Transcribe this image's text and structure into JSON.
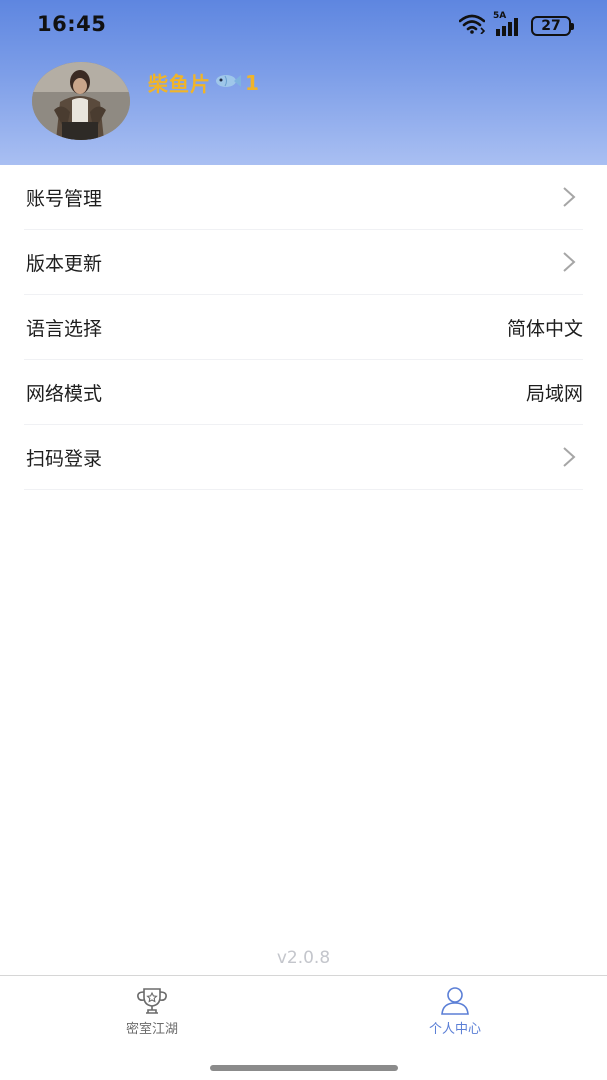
{
  "status_bar": {
    "time": "16:45",
    "network": "5A",
    "battery": "27"
  },
  "profile": {
    "username": "柴鱼片",
    "username_emoji": "🐟",
    "username_suffix": "1"
  },
  "menu": [
    {
      "label": "账号管理",
      "value": "",
      "chevron": true
    },
    {
      "label": "版本更新",
      "value": "",
      "chevron": true
    },
    {
      "label": "语言选择",
      "value": "简体中文",
      "chevron": false
    },
    {
      "label": "网络模式",
      "value": "局域网",
      "chevron": false
    },
    {
      "label": "扫码登录",
      "value": "",
      "chevron": true
    }
  ],
  "version": "v2.0.8",
  "tabbar": {
    "tabs": [
      {
        "label": "密室江湖",
        "icon": "trophy-icon",
        "active": false
      },
      {
        "label": "个人中心",
        "icon": "person-icon",
        "active": true
      }
    ]
  },
  "colors": {
    "header_gradient_top": "#5e86e0",
    "header_gradient_bottom": "#a9bff2",
    "username": "#f0b429",
    "tab_active": "#5b7fd6",
    "tab_inactive": "#6b6b6b"
  }
}
